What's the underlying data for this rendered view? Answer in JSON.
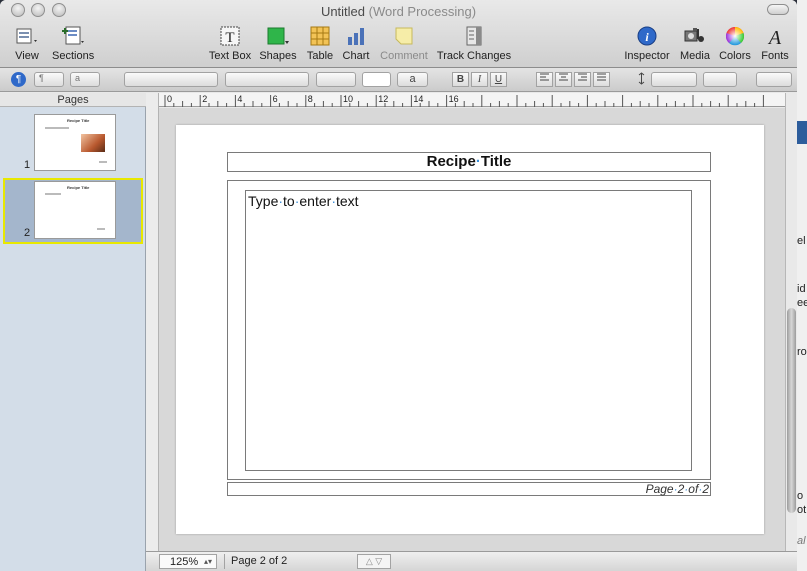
{
  "window": {
    "title": "Untitled",
    "subtitle": "(Word Processing)"
  },
  "toolbar": {
    "view": "View",
    "sections": "Sections",
    "text_box": "Text Box",
    "shapes": "Shapes",
    "table": "Table",
    "chart": "Chart",
    "comment": "Comment",
    "track_changes": "Track Changes",
    "inspector": "Inspector",
    "media": "Media",
    "colors": "Colors",
    "fonts": "Fonts"
  },
  "formatbar": {
    "paragraph_style": "¶",
    "char_style": "a",
    "bold": "B",
    "italic": "I",
    "underline": "U",
    "text_color_sample": "a"
  },
  "sidebar": {
    "header": "Pages",
    "pages": [
      {
        "number": "1",
        "thumb_title": "Recipe Title"
      },
      {
        "number": "2",
        "thumb_title": "Recipe Title",
        "selected": true
      }
    ]
  },
  "ruler": {
    "ticks": [
      "0",
      "2",
      "4",
      "6",
      "8",
      "10",
      "12",
      "14",
      "16"
    ]
  },
  "document": {
    "title": "Recipe·Title",
    "body_placeholder": "Type·to·enter·text",
    "footer": "Page·2·of·2"
  },
  "statusbar": {
    "zoom": "125%",
    "page_indicator": "Page 2 of 2"
  },
  "background_fragments": [
    "el",
    "id",
    "ee",
    "ro",
    "o",
    "ot",
    "al"
  ]
}
